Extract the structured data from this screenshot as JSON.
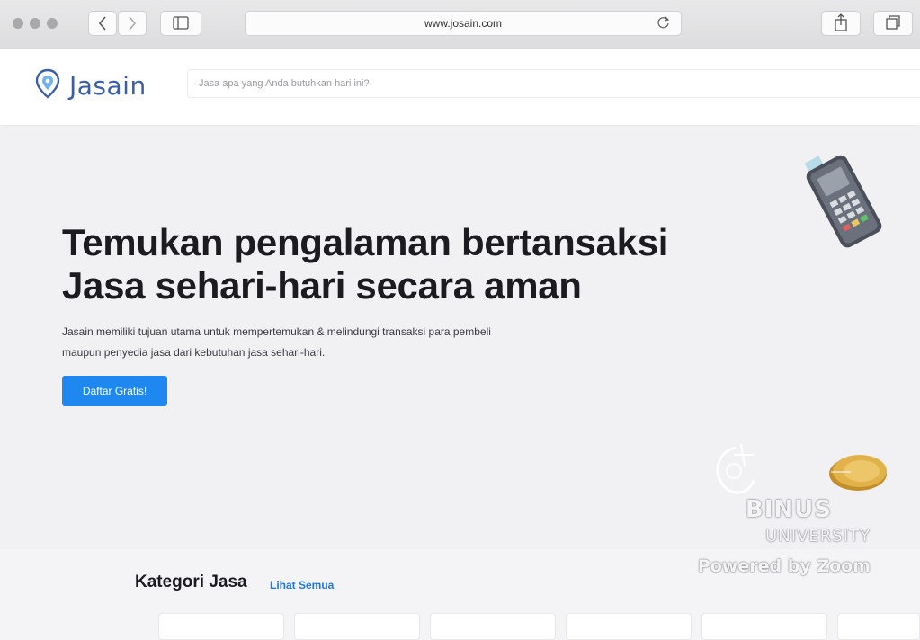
{
  "browser": {
    "url": "www.josain.com"
  },
  "header": {
    "logo_text": "Jasain",
    "search_placeholder": "Jasa apa yang Anda butuhkan hari ini?"
  },
  "hero": {
    "title_line1": "Temukan pengalaman bertansaksi",
    "title_line2": "Jasa sehari-hari secara aman",
    "desc_line1": "Jasain memiliki tujuan utama untuk mempertemukan & melindungi transaksi para pembeli",
    "desc_line2": "maupun penyedia jasa dari kebutuhan jasa sehari-hari.",
    "cta_label": "Daftar Gratis!"
  },
  "watermark": {
    "line1": "BINUS",
    "line2": "UNIVERSITY",
    "line3": "Powered by Zoom"
  },
  "categories": {
    "title": "Kategori Jasa",
    "see_all": "Lihat Semua"
  },
  "colors": {
    "brand": "#3b5ea6",
    "cta": "#1e88f0",
    "link": "#1e78e0"
  }
}
